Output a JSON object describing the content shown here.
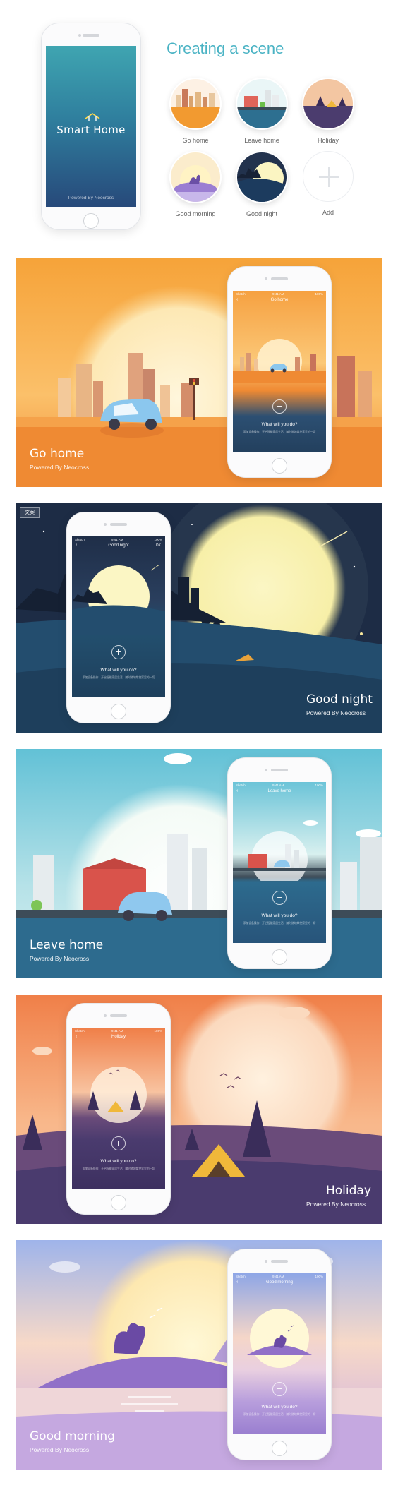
{
  "intro": {
    "brand": "Smart Home",
    "powered": "Powered By Neocross",
    "title": "Creating a scene",
    "scenes": [
      {
        "label": "Go home"
      },
      {
        "label": "Leave home"
      },
      {
        "label": "Holiday"
      },
      {
        "label": "Good morning"
      },
      {
        "label": "Good night"
      },
      {
        "label": "Add"
      }
    ]
  },
  "status_bar": {
    "carrier": "Sketch",
    "time": "9:41 AM",
    "battery": "100%"
  },
  "banners": {
    "go_home": {
      "title": "Go home",
      "subtitle": "Powered By Neocross",
      "screen_title": "Go home"
    },
    "good_night": {
      "title": "Good night",
      "subtitle": "Powered By Neocross",
      "screen_title": "Good night",
      "ok": "OK",
      "tag": "文案"
    },
    "leave_home": {
      "title": "Leave home",
      "subtitle": "Powered By Neocross",
      "screen_title": "Leave home"
    },
    "holiday": {
      "title": "Holiday",
      "subtitle": "Powered By Neocross",
      "screen_title": "Holiday"
    },
    "good_morning": {
      "title": "Good morning",
      "subtitle": "Powered By Neocross",
      "screen_title": "Good morning"
    }
  },
  "screen_common": {
    "question": "What will you do?",
    "hint": "添加设备操作，开启智能家居生活，随时随地掌控家里的一切"
  },
  "colors": {
    "accent": "#4ab3c4",
    "go_home": "#f0902c",
    "good_night": "#1f3352",
    "leave_home": "#2e6b8e",
    "holiday": "#4a3b6e",
    "good_morning": "#9a7fd0"
  }
}
